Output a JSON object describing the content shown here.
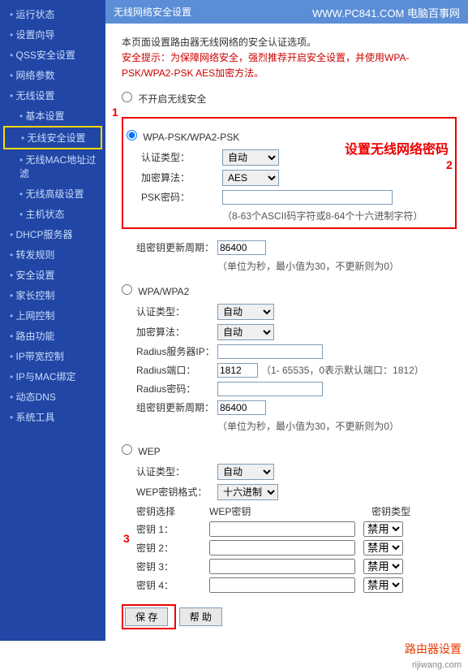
{
  "header": {
    "title": "无线网络安全设置",
    "url": "WWW.PC841.COM 电脑百事网"
  },
  "sidebar": {
    "items": [
      {
        "label": "运行状态"
      },
      {
        "label": "设置向导"
      },
      {
        "label": "QSS安全设置"
      },
      {
        "label": "网络参数"
      },
      {
        "label": "无线设置"
      },
      {
        "label": "基本设置",
        "sub": true
      },
      {
        "label": "无线安全设置",
        "sub": true,
        "highlight": true
      },
      {
        "label": "无线MAC地址过滤",
        "sub": true
      },
      {
        "label": "无线高级设置",
        "sub": true
      },
      {
        "label": "主机状态",
        "sub": true
      },
      {
        "label": "DHCP服务器"
      },
      {
        "label": "转发规则"
      },
      {
        "label": "安全设置"
      },
      {
        "label": "家长控制"
      },
      {
        "label": "上网控制"
      },
      {
        "label": "路由功能"
      },
      {
        "label": "IP带宽控制"
      },
      {
        "label": "IP与MAC绑定"
      },
      {
        "label": "动态DNS"
      },
      {
        "label": "系统工具"
      }
    ]
  },
  "tip": {
    "line1": "本页面设置路由器无线网络的安全认证选项。",
    "line2a": "安全提示：为保障网络安全，强烈推荐开启安全设置，并使用WPA-",
    "line2b": "PSK/WPA2-PSK AES加密方法。"
  },
  "radios": {
    "disable": "不开启无线安全",
    "wpapsk": "WPA-PSK/WPA2-PSK",
    "wpa": "WPA/WPA2",
    "wep": "WEP"
  },
  "wpapsk": {
    "auth_label": "认证类型：",
    "auth_value": "自动",
    "enc_label": "加密算法：",
    "enc_value": "AES",
    "psk_label": "PSK密码：",
    "psk_value": "",
    "psk_hint": "（8-63个ASCII码字符或8-64个十六进制字符）",
    "annot": "设置无线网络密码"
  },
  "rekey": {
    "label": "组密钥更新周期：",
    "value": "86400",
    "hint": "（单位为秒，最小值为30，不更新则为0）"
  },
  "wpa": {
    "auth_label": "认证类型：",
    "auth_value": "自动",
    "enc_label": "加密算法：",
    "enc_value": "自动",
    "radius_ip_label": "Radius服务器IP：",
    "radius_ip_value": "",
    "radius_port_label": "Radius端口：",
    "radius_port_value": "1812",
    "radius_port_hint": "（1- 65535，0表示默认端口：1812）",
    "radius_pw_label": "Radius密码：",
    "radius_pw_value": ""
  },
  "wep": {
    "auth_label": "认证类型：",
    "auth_value": "自动",
    "fmt_label": "WEP密钥格式：",
    "fmt_value": "十六进制",
    "head_sel": "密钥选择",
    "head_key": "WEP密钥",
    "head_type": "密钥类型",
    "keys": [
      {
        "label": "密钥 1：",
        "val": "",
        "type": "禁用"
      },
      {
        "label": "密钥 2：",
        "val": "",
        "type": "禁用"
      },
      {
        "label": "密钥 3：",
        "val": "",
        "type": "禁用"
      },
      {
        "label": "密钥 4：",
        "val": "",
        "type": "禁用"
      }
    ]
  },
  "buttons": {
    "save": "保 存",
    "help": "帮 助"
  },
  "annotations": {
    "n1": "1",
    "n2": "2",
    "n3": "3"
  },
  "watermark": {
    "main": "路由器设置",
    "sub": "rijiwang.com"
  }
}
